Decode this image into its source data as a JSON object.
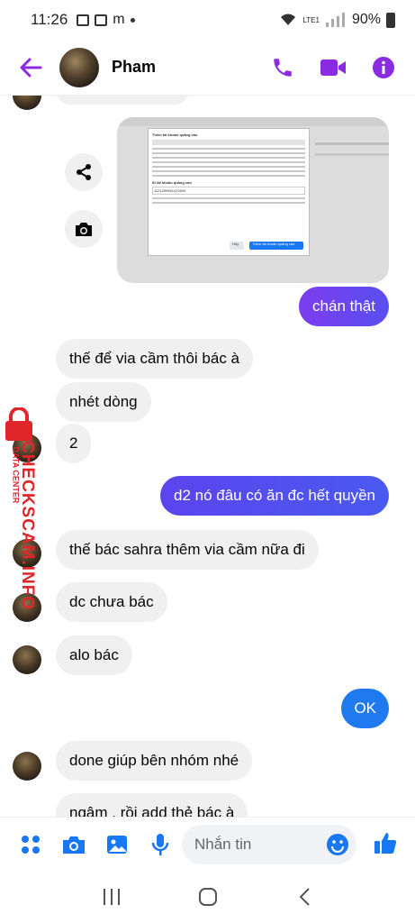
{
  "status_bar": {
    "time": "11:26",
    "carrier_label": "LTE1",
    "battery": "90%"
  },
  "header": {
    "contact_name": "Pham",
    "accent_color": "#8a2be2"
  },
  "messages": [
    {
      "side": "out",
      "text": "chán thật"
    },
    {
      "side": "in",
      "text": "thế để via cầm thôi bác à"
    },
    {
      "side": "in",
      "text": "nhét dòng"
    },
    {
      "side": "in",
      "text": "2"
    },
    {
      "side": "out",
      "text": "d2 nó đâu có ăn đc hết quyền"
    },
    {
      "side": "in",
      "text": "thế bác sahra thêm via cầm nữa đi"
    },
    {
      "side": "in",
      "text": "dc chưa bác"
    },
    {
      "side": "in",
      "text": "alo bác"
    },
    {
      "side": "out",
      "text": "OK"
    },
    {
      "side": "in",
      "text": "done giúp bên nhóm nhé"
    },
    {
      "side": "in",
      "text": "ngâm , rồi add thẻ bác à"
    }
  ],
  "shared_image": {
    "dialog_title": "Thêm tài khoản quảng cáo",
    "field_label": "ID tài khoản quảng cáo",
    "field_value": "1121299551470609",
    "cancel_label": "Hủy",
    "confirm_label": "Thêm tài khoản quảng cáo"
  },
  "watermark": {
    "brand": "CHECKSCAM.INFO",
    "sub": "DATA CENTER"
  },
  "composer": {
    "placeholder": "Nhắn tin"
  },
  "icons": {
    "back": "arrow-left-icon",
    "call": "phone-icon",
    "video": "video-camera-icon",
    "info": "info-icon",
    "share": "share-icon",
    "camera": "camera-icon",
    "apps": "apps-grid-icon",
    "gallery": "image-icon",
    "mic": "microphone-icon",
    "emoji": "emoji-icon",
    "like": "thumbs-up-icon"
  }
}
